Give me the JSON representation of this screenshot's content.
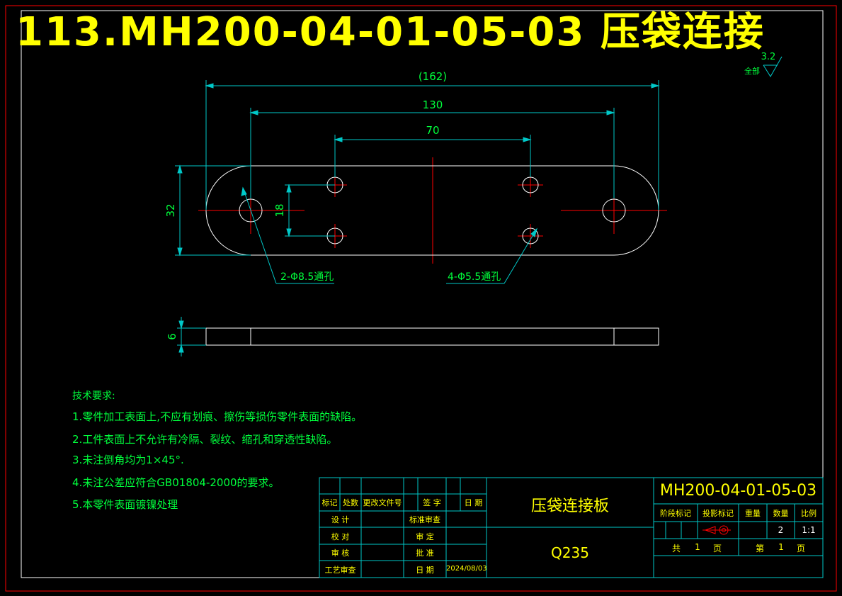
{
  "title": "113.MH200-04-01-05-03 压袋连接",
  "roughness": {
    "value": "3.2",
    "label": "全部"
  },
  "dimensions": {
    "overall": "(162)",
    "hole_spacing_large": "130",
    "hole_spacing_small": "70",
    "height": "32",
    "hole_vertical": "18",
    "thickness": "6",
    "large_holes": "2-Φ8.5通孔",
    "small_holes": "4-Φ5.5通孔"
  },
  "requirements": {
    "heading": "技术要求:",
    "items": [
      "1.零件加工表面上,不应有划痕、擦伤等损伤零件表面的缺陷。",
      "2.工件表面上不允许有冷隔、裂纹、缩孔和穿透性缺陷。",
      "3.未注倒角均为1×45°.",
      "4.未注公差应符合GB01804-2000的要求。",
      "5.本零件表面镀镍处理"
    ]
  },
  "title_block": {
    "part_name": "压袋连接板",
    "material": "Q235",
    "drawing_no": "MH200-04-01-05-03",
    "headers": {
      "mark": "标记",
      "count": "处数",
      "change_doc": "更改文件号",
      "sign": "签 字",
      "date": "日 期",
      "design": "设 计",
      "check": "校 对",
      "review": "审 核",
      "process": "工艺审查",
      "std_review": "标准审查",
      "approve_rev": "审 定",
      "approve": "批 准",
      "date2": "日 期",
      "stage": "阶段标记",
      "projection": "投影标记",
      "weight": "重量",
      "quantity": "数量",
      "scale": "比例"
    },
    "date_value": "2024/08/03",
    "quantity_value": "2",
    "scale_value": "1:1",
    "total_label": "共",
    "total_value": "1",
    "page_unit": "页",
    "page_label": "第",
    "page_value": "1",
    "page_unit2": "页"
  },
  "colors": {
    "background": "#000000",
    "frame": "#ff0000",
    "outline": "#ffffff",
    "dimension": "#00c8c8",
    "centerline": "#ff0000",
    "text_dim": "#00ff3c",
    "title": "#ffff00"
  }
}
